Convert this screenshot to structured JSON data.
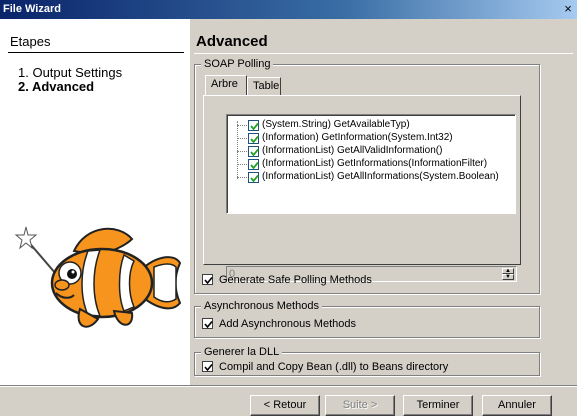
{
  "window": {
    "title": "File Wizard",
    "close": "×"
  },
  "sidebar": {
    "heading": "Etapes",
    "steps": [
      {
        "label": "1. Output Settings"
      },
      {
        "label": "2. Advanced"
      }
    ]
  },
  "page": {
    "title": "Advanced"
  },
  "soap": {
    "legend": "SOAP Polling",
    "tabs": [
      {
        "label": "Arbre"
      },
      {
        "label": "Table"
      }
    ],
    "methods": [
      {
        "label": "(System.String) GetAvailableTyp)",
        "checked": true
      },
      {
        "label": "(Information) GetInformation(System.Int32)",
        "checked": true
      },
      {
        "label": "(InformationList) GetAllValidInformation()",
        "checked": true
      },
      {
        "label": "(InformationList) GetInformations(InformationFilter)",
        "checked": true
      },
      {
        "label": "(InformationList) GetAllInformations(System.Boolean)",
        "checked": true
      }
    ],
    "spinner_value": "0",
    "generate_safe": {
      "label": "Generate Safe Polling Methods",
      "checked": true
    }
  },
  "async": {
    "legend": "Asynchronous Methods",
    "add": {
      "label": "Add Asynchronous Methods",
      "checked": true
    }
  },
  "dll": {
    "legend": "Generer la DLL",
    "compile": {
      "label": "Compil and Copy Bean (.dll) to Beans directory",
      "checked": true
    }
  },
  "buttons": {
    "back": "< Retour",
    "next": "Suite >",
    "finish": "Terminer",
    "cancel": "Annuler"
  },
  "colors": {
    "titlebar_start": "#0a246a",
    "titlebar_end": "#a6caf0",
    "check": "#21a121"
  }
}
